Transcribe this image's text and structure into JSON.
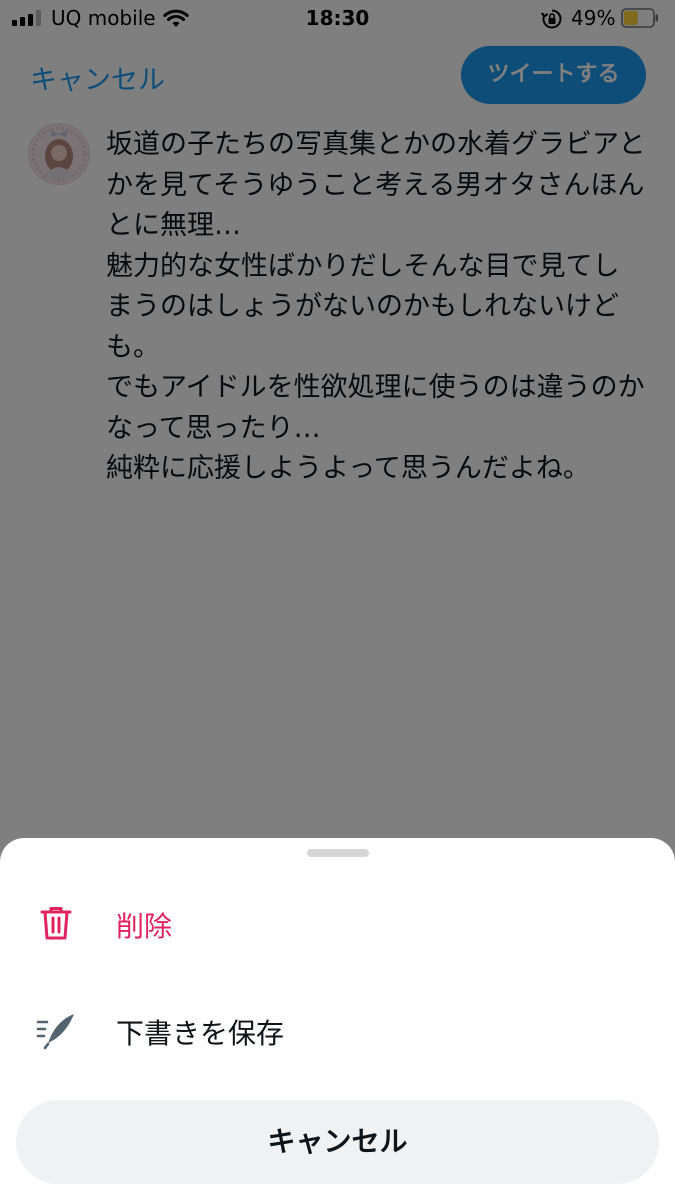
{
  "status_bar": {
    "carrier": "UQ mobile",
    "time": "18:30",
    "battery_percent": "49%",
    "battery_level": 0.49,
    "battery_color": "#ffd43b",
    "icons": [
      "cellular-signal-icon",
      "wifi-icon",
      "rotation-lock-icon",
      "battery-icon"
    ]
  },
  "compose": {
    "cancel_label": "キャンセル",
    "tweet_button_label": "ツイートする",
    "text": "坂道の子たちの写真集とかの水着グラビアとかを見てそうゆうこと考える男オタさんほんとに無理…\n魅力的な女性ばかりだしそんな目で見てしまうのはしょうがないのかもしれないけども。\nでもアイドルを性欲処理に使うのは違うのかなって思ったり…\n純粋に応援しようよって思うんだよね。"
  },
  "action_sheet": {
    "items": [
      {
        "label": "削除",
        "icon": "trash-icon",
        "color": "#e0245e"
      },
      {
        "label": "下書きを保存",
        "icon": "quill-draft-icon",
        "color": "#0f1419"
      }
    ],
    "cancel_label": "キャンセル"
  },
  "colors": {
    "accent": "#1d9bf0",
    "destructive": "#e0245e",
    "overlay": "rgba(0,0,0,0.5)"
  }
}
